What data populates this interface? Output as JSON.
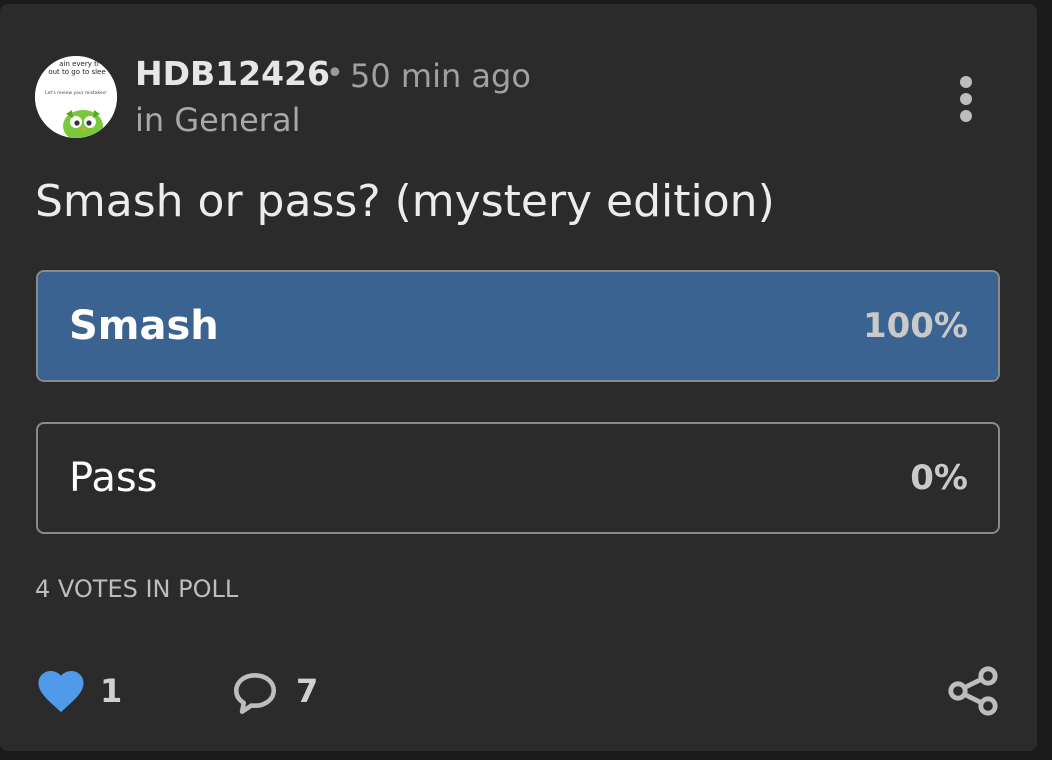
{
  "post": {
    "author": {
      "username": "HDB12426",
      "avatar_text_line1": "ain every ti",
      "avatar_text_line2": "out to go to slee",
      "avatar_text_line3": "Let's review your mistakes!"
    },
    "separator": "•",
    "timestamp": "50 min ago",
    "category": "in General",
    "title": "Smash or pass? (mystery edition)"
  },
  "poll": {
    "options": [
      {
        "label": "Smash",
        "percent_text": "100%",
        "fraction": 1.0,
        "selected": true
      },
      {
        "label": "Pass",
        "percent_text": "0%",
        "fraction": 0.0,
        "selected": false
      }
    ],
    "votes_text": "4 VOTES IN POLL"
  },
  "actions": {
    "likes": "1",
    "comments": "7"
  },
  "colors": {
    "card_bg": "#2b2b2b",
    "poll_fill": "#3a6391",
    "heart": "#4f9be9"
  },
  "icons": {
    "more": "more-vertical-icon",
    "like": "heart-icon",
    "comment": "comment-bubble-icon",
    "share": "share-icon"
  }
}
